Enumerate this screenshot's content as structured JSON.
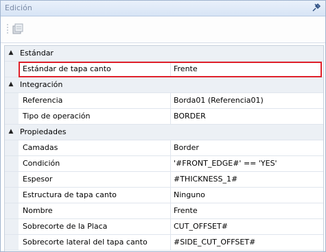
{
  "window": {
    "title": "Edición"
  },
  "colors": {
    "highlight": "#e0202a"
  },
  "categories": [
    {
      "label": "Estándar",
      "rows": [
        {
          "name": "Estándar de tapa canto",
          "value": "Frente"
        }
      ]
    },
    {
      "label": "Integración",
      "rows": [
        {
          "name": "Referencia",
          "value": "Borda01 (Referencia01)"
        },
        {
          "name": "Tipo de operación",
          "value": "BORDER"
        }
      ]
    },
    {
      "label": "Propiedades",
      "rows": [
        {
          "name": "Camadas",
          "value": "Border"
        },
        {
          "name": "Condición",
          "value": "'#FRONT_EDGE#' == 'YES'"
        },
        {
          "name": "Espesor",
          "value": "#THICKNESS_1#"
        },
        {
          "name": "Estructura de tapa canto",
          "value": "Ninguno"
        },
        {
          "name": "Nombre",
          "value": "Frente"
        },
        {
          "name": "Sobrecorte de la Placa",
          "value": "CUT_OFFSET#"
        },
        {
          "name": "Sobrecorte lateral del tapa canto",
          "value": "#SIDE_CUT_OFFSET#"
        }
      ]
    }
  ]
}
